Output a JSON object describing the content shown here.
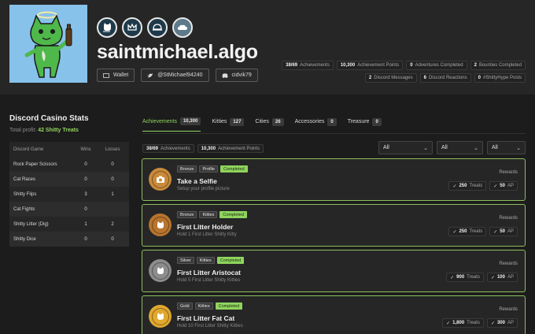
{
  "profile": {
    "username": "saintmichael.algo",
    "links": {
      "wallet": "Wallet",
      "twitter": "@StMichael94240",
      "discord": "cidvik79"
    },
    "badges": [
      {
        "icon": "cat-badge-icon"
      },
      {
        "icon": "crown-badge-icon"
      },
      {
        "icon": "helmet-badge-icon"
      },
      {
        "icon": "cloud-badge-icon"
      }
    ]
  },
  "profile_stats": {
    "row1": [
      {
        "value": "38/69",
        "label": "Achievements"
      },
      {
        "value": "10,300",
        "label": "Achievement Points"
      },
      {
        "value": "0",
        "label": "Adventures Completed"
      },
      {
        "value": "2",
        "label": "Bounties Completed"
      }
    ],
    "row2": [
      {
        "value": "2",
        "label": "Discord Messages"
      },
      {
        "value": "6",
        "label": "Discord Reactions"
      },
      {
        "value": "0",
        "label": "#ShittyHype Posts"
      }
    ]
  },
  "casino": {
    "title": "Discord Casino Stats",
    "profit_label": "Total profit:",
    "profit_value": "42 Shitty Treats",
    "headers": {
      "game": "Discord Game",
      "wins": "Wins",
      "losses": "Losses"
    },
    "rows": [
      {
        "game": "Rock Paper Scissors",
        "wins": "0",
        "losses": "0"
      },
      {
        "game": "Cat Races",
        "wins": "0",
        "losses": "0"
      },
      {
        "game": "Shitty Flips",
        "wins": "3",
        "losses": "1"
      },
      {
        "game": "Cat Fights",
        "wins": "0",
        "losses": ""
      },
      {
        "game": "Shitty Litter (Dig)",
        "wins": "1",
        "losses": "2"
      },
      {
        "game": "Shitty Dice",
        "wins": "0",
        "losses": "0"
      }
    ]
  },
  "tabs": [
    {
      "label": "Achievements",
      "count": "10,300"
    },
    {
      "label": "Kitties",
      "count": "127"
    },
    {
      "label": "Cities",
      "count": "26"
    },
    {
      "label": "Accessories",
      "count": "0"
    },
    {
      "label": "Treasure",
      "count": "0"
    }
  ],
  "summary": [
    {
      "value": "38/69",
      "label": "Achievements"
    },
    {
      "value": "10,300",
      "label": "Achievement Points"
    }
  ],
  "filters": [
    "All",
    "All",
    "All"
  ],
  "achievements": [
    {
      "tier": "Bronze",
      "category": "Profile",
      "status": "Completed",
      "title": "Take a Selfie",
      "desc": "Setup your profile picture",
      "rewards_label": "Rewards",
      "treats": "250",
      "treats_unit": "Treats",
      "ap": "50",
      "ap_unit": "AP",
      "icon": "camera-icon",
      "color": "#c98a3a"
    },
    {
      "tier": "Bronze",
      "category": "Kitties",
      "status": "Completed",
      "title": "First Litter Holder",
      "desc": "Hold 1 First Litter Shitty Kitty",
      "rewards_label": "Rewards",
      "treats": "250",
      "treats_unit": "Treats",
      "ap": "50",
      "ap_unit": "AP",
      "icon": "cat-icon",
      "color": "#b8742e"
    },
    {
      "tier": "Silver",
      "category": "Kitties",
      "status": "Completed",
      "title": "First Litter Aristocat",
      "desc": "Hold 5 First Litter Shitty Kitties",
      "rewards_label": "Rewards",
      "treats": "900",
      "treats_unit": "Treats",
      "ap": "100",
      "ap_unit": "AP",
      "icon": "cat-icon",
      "color": "#8c8c8c"
    },
    {
      "tier": "Gold",
      "category": "Kitties",
      "status": "Completed",
      "title": "First Litter Fat Cat",
      "desc": "Hold 10 First Litter Shitty Kitties",
      "rewards_label": "Rewards",
      "treats": "1,800",
      "treats_unit": "Treats",
      "ap": "300",
      "ap_unit": "AP",
      "icon": "cat-icon",
      "color": "#e0a82e"
    }
  ]
}
